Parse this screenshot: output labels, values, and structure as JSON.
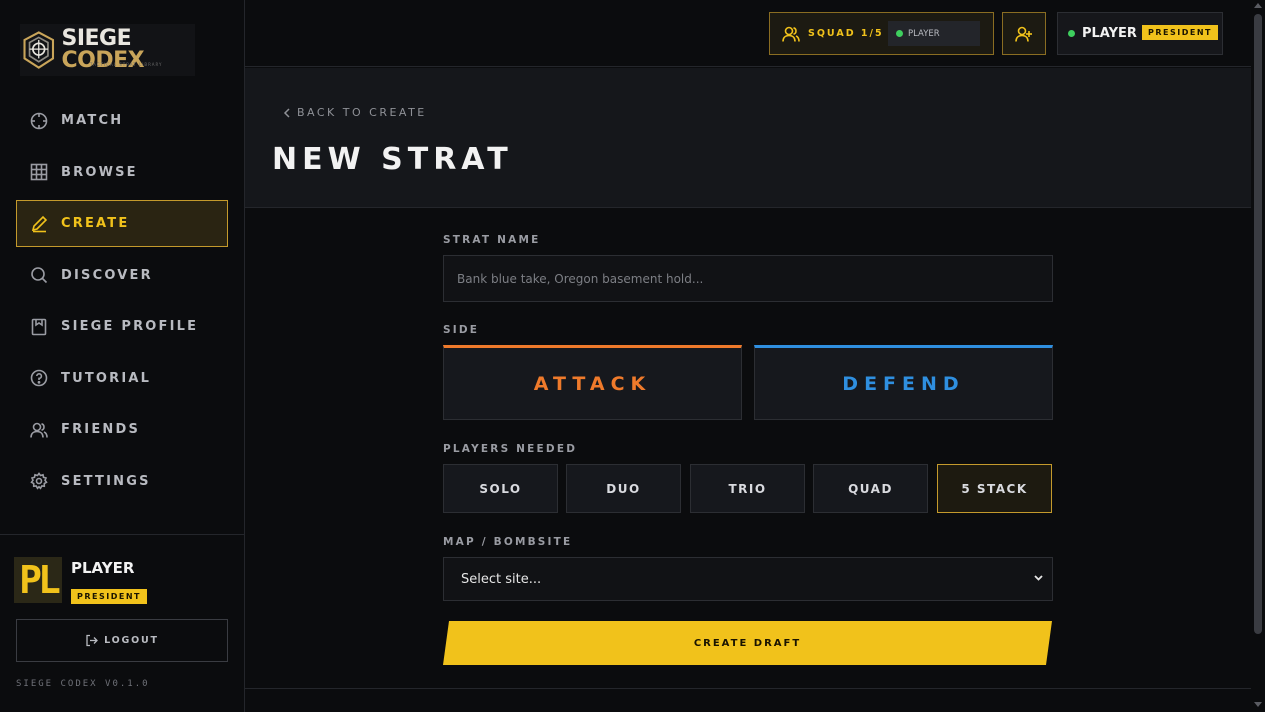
{
  "app": {
    "logo_text": "SIEGE CODEX",
    "logo_subtitle": "TACTICAL STRAT LIBRARY",
    "version": "SIEGE CODEX V0.1.0"
  },
  "sidebar": {
    "items": [
      {
        "label": "MATCH",
        "icon": "crosshair-icon"
      },
      {
        "label": "BROWSE",
        "icon": "grid-icon"
      },
      {
        "label": "CREATE",
        "icon": "pencil-icon",
        "active": true
      },
      {
        "label": "DISCOVER",
        "icon": "search-icon"
      },
      {
        "label": "SIEGE PROFILE",
        "icon": "profile-card-icon"
      },
      {
        "label": "TUTORIAL",
        "icon": "help-circle-icon"
      },
      {
        "label": "FRIENDS",
        "icon": "users-icon"
      },
      {
        "label": "SETTINGS",
        "icon": "gear-icon"
      }
    ],
    "user": {
      "avatar_initials": "PL",
      "name": "PLAYER",
      "role": "PRESIDENT"
    },
    "logout_label": "LOGOUT"
  },
  "topbar": {
    "squad_label": "SQUAD 1/5",
    "squad_member": "PLAYER",
    "user_name": "PLAYER",
    "user_role": "PRESIDENT"
  },
  "header": {
    "back_label": "BACK TO CREATE",
    "title": "NEW STRAT"
  },
  "form": {
    "strat_name_label": "STRAT NAME",
    "strat_name_placeholder": "Bank blue take, Oregon basement hold...",
    "strat_name_value": "",
    "side_label": "SIDE",
    "side_attack": "ATTACK",
    "side_defend": "DEFEND",
    "players_label": "PLAYERS NEEDED",
    "players_options": [
      "SOLO",
      "DUO",
      "TRIO",
      "QUAD",
      "5 STACK"
    ],
    "players_selected": "5 STACK",
    "map_label": "MAP / BOMBSITE",
    "map_selected": "Select site...",
    "submit_label": "CREATE DRAFT"
  },
  "colors": {
    "accent": "#f1c21b",
    "attack": "#ef7a2b",
    "defend": "#2f8fe0",
    "online": "#3ecf5e",
    "background": "#0b0c0e"
  }
}
